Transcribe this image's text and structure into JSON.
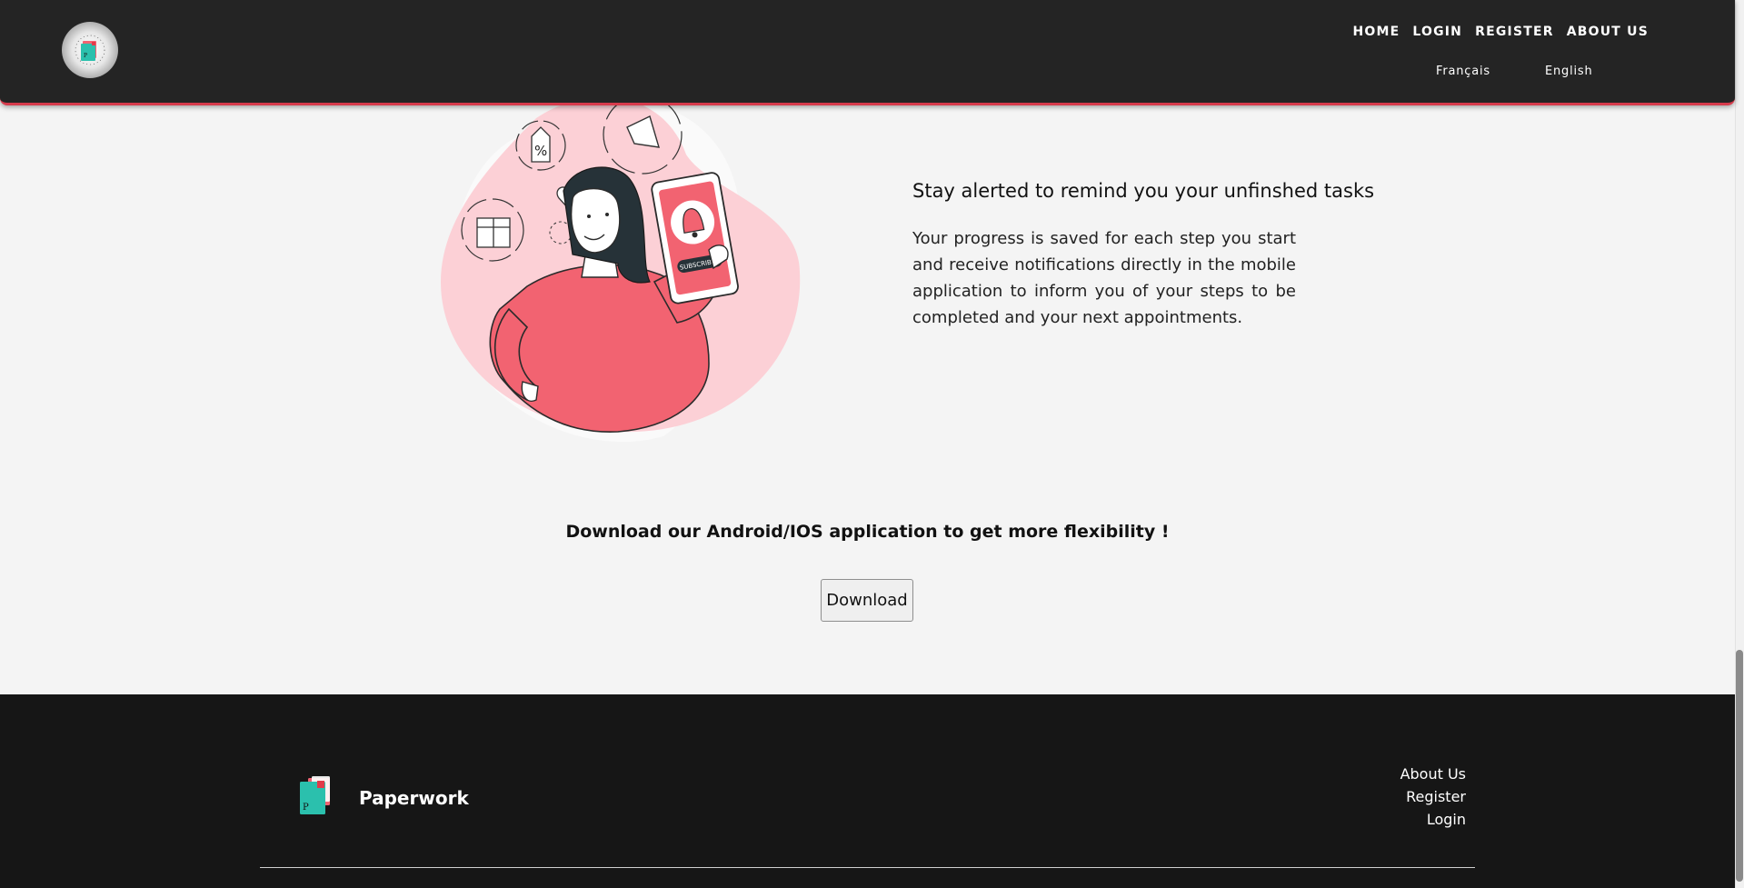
{
  "header": {
    "nav": [
      "HOME",
      "LOGIN",
      "REGISTER",
      "ABOUT US"
    ],
    "languages": [
      "Français",
      "English"
    ]
  },
  "feature": {
    "title": "Stay alerted to remind you your unfinshed tasks",
    "text": "Your progress is saved for each step you start and receive notifications directly in the mobile application to inform you of your steps to be completed and your next appointments.",
    "illustration_badge": "SUBSCRIBED"
  },
  "download": {
    "title": "Download our Android/IOS application to get more flexibility !",
    "button": "Download"
  },
  "footer": {
    "brand": "Paperwork",
    "links": [
      "About Us",
      "Register",
      "Login"
    ]
  },
  "colors": {
    "accent": "#d73b4c",
    "header_bg": "#242424",
    "footer_bg": "#161616",
    "page_bg": "#f4f4f4",
    "illustration_pink": "#f26371",
    "illustration_light_pink": "#fcd0d6",
    "logo_teal": "#2bc0ad"
  }
}
